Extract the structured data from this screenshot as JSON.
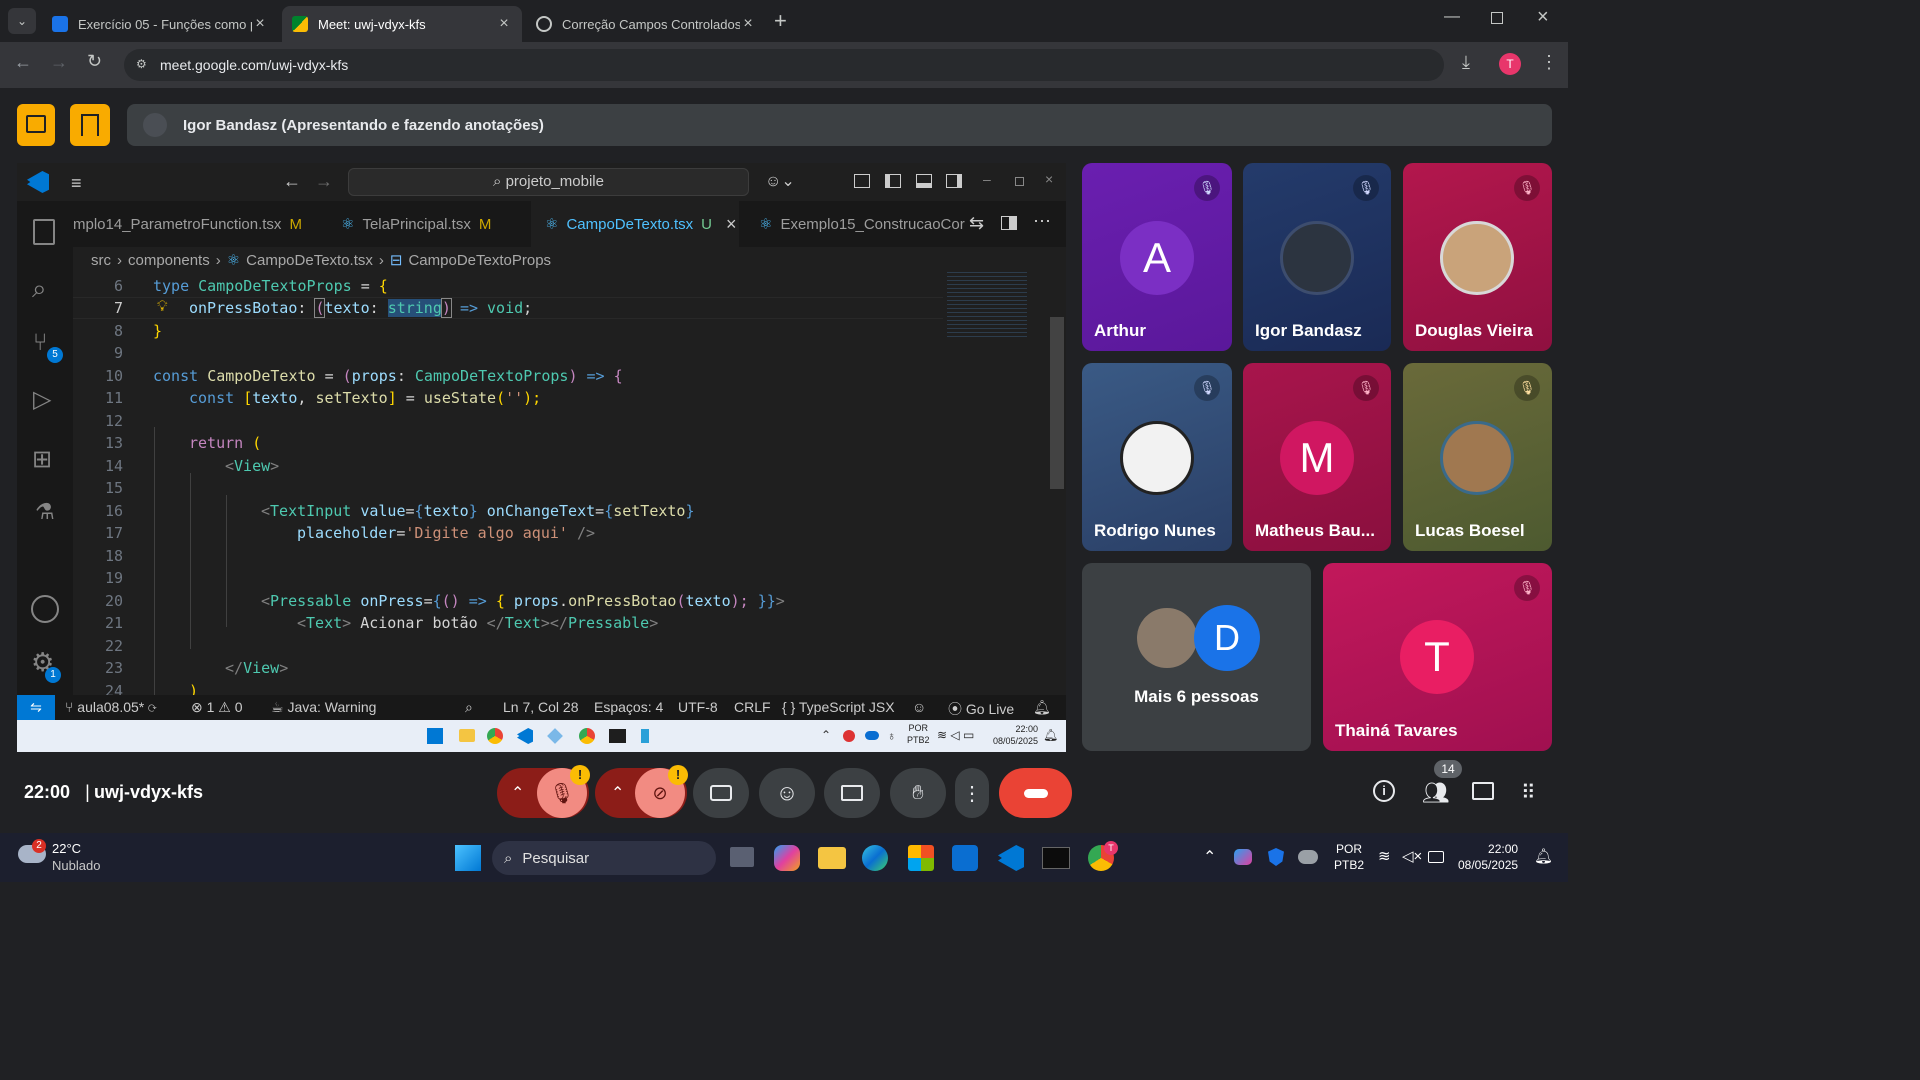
{
  "browser": {
    "tabs": [
      {
        "title": "Exercício 05 - Funções como pa",
        "active": false
      },
      {
        "title": "Meet: uwj-vdyx-kfs",
        "active": true
      },
      {
        "title": "Correção Campos Controlados",
        "active": false
      }
    ],
    "url": "meet.google.com/uwj-vdyx-kfs",
    "profile_initial": "T"
  },
  "meet": {
    "presenter_banner": "Igor Bandasz (Apresentando e fazendo anotações)",
    "time": "22:00",
    "separator": "|",
    "meeting_code": "uwj-vdyx-kfs",
    "participants_count": "14",
    "participants": [
      {
        "name": "Arthur",
        "initial": "A",
        "muted": true
      },
      {
        "name": "Igor Bandasz",
        "muted": true
      },
      {
        "name": "Douglas Vieira",
        "muted": true
      },
      {
        "name": "Rodrigo Nunes",
        "muted": true
      },
      {
        "name": "Matheus Bau...",
        "initial": "M",
        "muted": true
      },
      {
        "name": "Lucas Boesel",
        "muted": true
      }
    ],
    "more_people": {
      "label": "Mais 6 pessoas",
      "initial": "D"
    },
    "self_tile": {
      "name": "Thainá Tavares",
      "initial": "T",
      "muted": true
    },
    "warning_glyph": "!"
  },
  "vscode": {
    "search_text": "projeto_mobile",
    "tabs": [
      {
        "label": "mplo14_ParametroFunction.tsx",
        "status": "M",
        "active": false
      },
      {
        "label": "TelaPrincipal.tsx",
        "status": "M",
        "active": false
      },
      {
        "label": "CampoDeTexto.tsx",
        "status": "U",
        "active": true
      },
      {
        "label": "Exemplo15_ConstrucaoCor",
        "status": "",
        "active": false
      }
    ],
    "breadcrumb": [
      "src",
      "components",
      "CampoDeTexto.tsx",
      "CampoDeTextoProps"
    ],
    "source_control_badge": "5",
    "settings_badge": "1",
    "line_numbers": [
      "6",
      "7",
      "8",
      "9",
      "10",
      "11",
      "12",
      "13",
      "14",
      "15",
      "16",
      "17",
      "18",
      "19",
      "20",
      "21",
      "22",
      "23",
      "24"
    ],
    "current_line": "7",
    "code": {
      "l6": [
        "type",
        "CampoDeTextoProps",
        "=",
        "{"
      ],
      "l7": [
        "onPressBotao",
        ":",
        "(",
        "texto",
        ":",
        "string",
        ")",
        "=>",
        "void",
        ";"
      ],
      "l8": [
        "}"
      ],
      "l10": [
        "const",
        "CampoDeTexto",
        "=",
        "(",
        "props",
        ":",
        "CampoDeTextoProps",
        ")",
        "=>",
        "{"
      ],
      "l11": [
        "const",
        "[",
        "texto",
        ",",
        "setTexto",
        "]",
        "=",
        "useState",
        "(",
        "''",
        ");"
      ],
      "l13": [
        "return",
        "("
      ],
      "l14": [
        "<",
        "View",
        ">"
      ],
      "l16": [
        "<",
        "TextInput",
        "value",
        "=",
        "{",
        "texto",
        "}",
        "onChangeText",
        "=",
        "{",
        "setTexto",
        "}"
      ],
      "l17": [
        "placeholder",
        "=",
        "'Digite algo aqui'",
        "/>"
      ],
      "l20": [
        "<",
        "Pressable",
        "onPress",
        "=",
        "{",
        "()",
        "=>",
        "{",
        "props",
        ".",
        "onPressBotao",
        "(",
        "texto",
        ");",
        "}}",
        ">"
      ],
      "l21": [
        "<",
        "Text",
        ">",
        "Acionar botão",
        "</",
        "Text",
        "></",
        "Pressable",
        ">"
      ],
      "l23": [
        "</",
        "View",
        ">"
      ],
      "l24": [
        ")"
      ]
    },
    "status": {
      "branch": "aula08.05*",
      "errors": "1",
      "warnings": "0",
      "java": "Java: Warning",
      "position": "Ln 7, Col 28",
      "spaces": "Espaços: 4",
      "encoding": "UTF-8",
      "eol": "CRLF",
      "language_braces": "{ }",
      "language": "TypeScript JSX",
      "golive": "Go Live"
    },
    "inner_taskbar": {
      "lang1": "POR",
      "lang2": "PTB2",
      "time": "22:00",
      "date": "08/05/2025"
    }
  },
  "taskbar": {
    "weather_badge": "2",
    "temperature": "22°C",
    "condition": "Nublado",
    "search": "Pesquisar",
    "chrome_badge": "T",
    "lang1": "POR",
    "lang2": "PTB2",
    "time": "22:00",
    "date": "08/05/2025"
  },
  "colors": {
    "accent_blue": "#4fc1ff",
    "meet_red": "#ea4335",
    "meet_yellow": "#f9ab00",
    "muted_btn": "#f28b82"
  }
}
